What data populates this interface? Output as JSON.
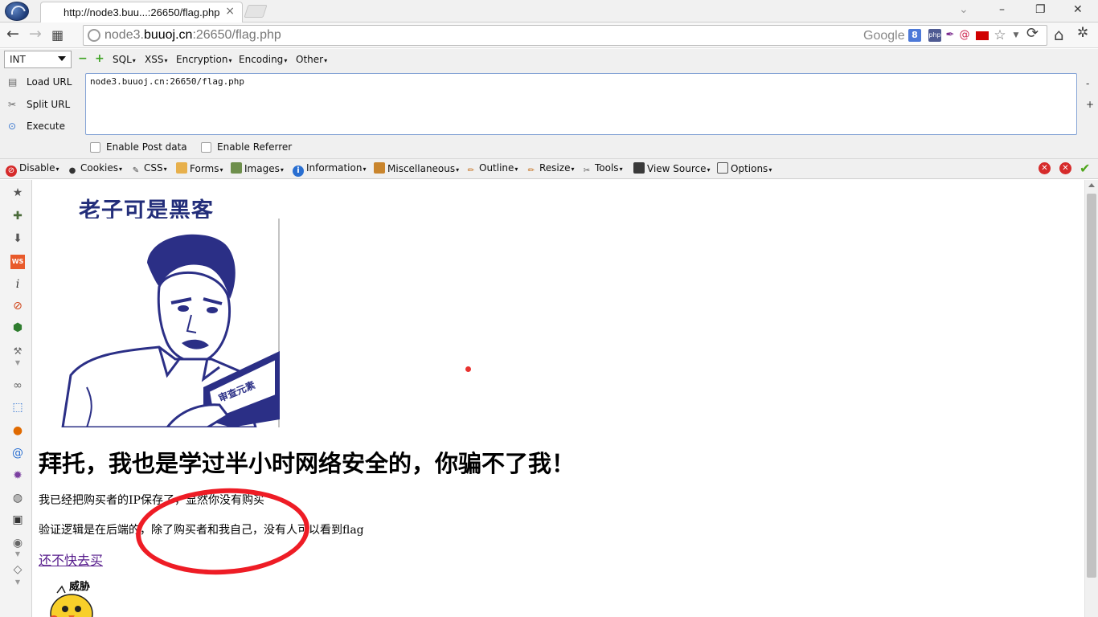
{
  "browser": {
    "tab": {
      "title": "http://node3.buu...:26650/flag.php",
      "close": "×"
    },
    "window_controls": {
      "minimize": "–",
      "maximize": "❐",
      "close": "✕",
      "dropdown": "⌄"
    },
    "nav": {
      "back": "←",
      "forward": "→",
      "apps": "▦",
      "reload": "⟳",
      "home": "⌂",
      "wrench": "✲"
    },
    "address": {
      "prefix": "node3.",
      "host": "buuoj.cn",
      "suffix": ":26650/flag.php"
    },
    "search_engine": "Google",
    "search_badge": "8",
    "php_badge": "php"
  },
  "hackbar": {
    "select_value": "INT",
    "minus": "−",
    "plus": "+",
    "menus": [
      "SQL",
      "XSS",
      "Encryption",
      "Encoding",
      "Other"
    ],
    "load_url": "Load URL",
    "split_url": "Split URL",
    "execute": "Execute",
    "url_text": "node3.buuoj.cn:26650/flag.php",
    "side_minus": "-",
    "side_plus": "+",
    "enable_post": "Enable Post data",
    "enable_referrer": "Enable Referrer"
  },
  "devbar": {
    "items": [
      "Disable",
      "Cookies",
      "CSS",
      "Forms",
      "Images",
      "Information",
      "Miscellaneous",
      "Outline",
      "Resize",
      "Tools",
      "View Source",
      "Options"
    ]
  },
  "page": {
    "meme_caption": "老子可是黑客",
    "heading": "拜托，我也是学过半小时网络安全的，你骗不了我！",
    "line1": "我已经把购买者的IP保存了，显然你没有购买",
    "line2": "验证逻辑是在后端的，除了购买者和我自己，没有人可以看到flag",
    "link": "还不快去买",
    "threat": "威胁"
  },
  "colors": {
    "annotation_red": "#ee1c25",
    "link_visited": "#551a8b",
    "meme_ink": "#232e7a"
  }
}
